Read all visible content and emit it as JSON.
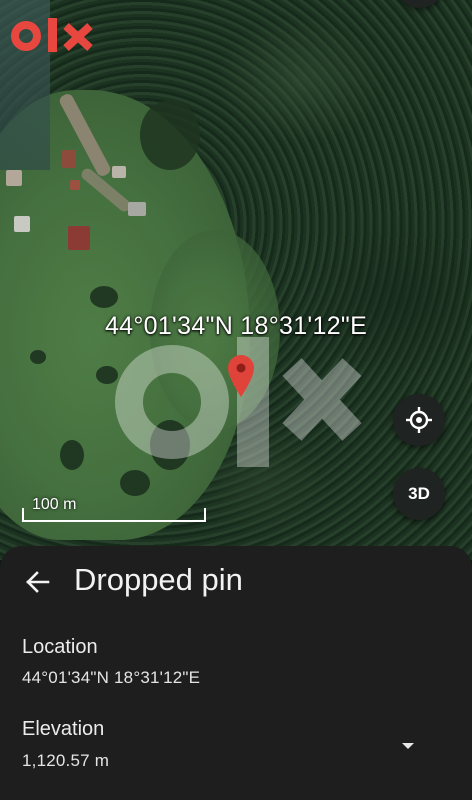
{
  "map": {
    "coordinates_label": "44°01'34\"N 18°31'12\"E",
    "scale_label": "100 m",
    "three_d_label": "3D",
    "watermark_brand": "OLX"
  },
  "sheet": {
    "title": "Dropped pin",
    "location": {
      "label": "Location",
      "value": "44°01'34\"N 18°31'12\"E"
    },
    "elevation": {
      "label": "Elevation",
      "value": "1,120.57 m"
    }
  },
  "colors": {
    "olx_red": "#e8473f",
    "pin_red": "#e0433a",
    "sheet_bg": "#1e1e1e",
    "fab_bg": "#1f2321"
  },
  "icons": {
    "back": "arrow-back-icon",
    "locate": "my-location-icon",
    "expand": "dropdown-arrow-icon",
    "pin": "map-pin-icon"
  }
}
